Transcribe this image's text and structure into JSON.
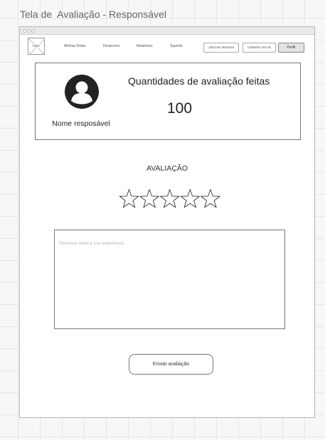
{
  "page": {
    "title": "Tela de  Avaliação - Responsável"
  },
  "logo": {
    "label": "logo"
  },
  "nav": {
    "links": [
      "Minhas Rotas",
      "Financeiro",
      "Relatórios",
      "Suporte"
    ],
    "buttons": {
      "add_driver": "Adicionar Motorista",
      "register_vehicle": "Cadastrar Veículo",
      "profile": "Perfil"
    }
  },
  "stats": {
    "label": "Quantidades de avaliação feitas",
    "value": "100",
    "responsible_name": "Nome resposável",
    "avatar_icon": "user-avatar-icon"
  },
  "rating": {
    "title": "AVALIAÇÃO",
    "max_stars": 5,
    "selected": 0,
    "star_icon": "star-outline-icon"
  },
  "comment": {
    "placeholder": "Descreva sobre a sua experiencia",
    "value": ""
  },
  "submit": {
    "label": "Enviar  avaliação"
  },
  "colors": {
    "avatar": "#222222",
    "border": "#777777",
    "canvas": "#f7f7f7",
    "grid": "#e6e6e6"
  }
}
